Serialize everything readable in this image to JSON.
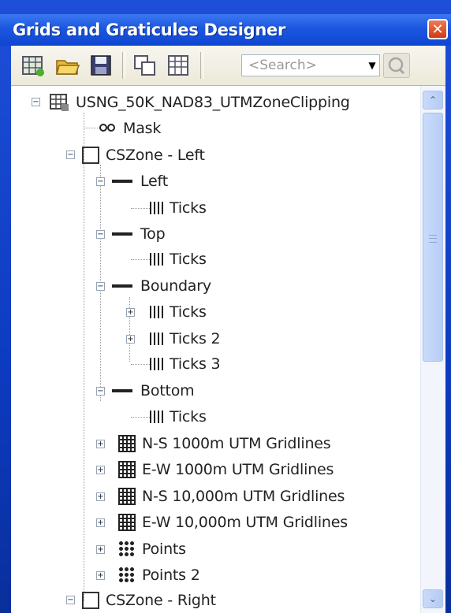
{
  "window": {
    "title": "Grids and Graticules Designer",
    "close_glyph": "✕"
  },
  "toolbar": {
    "buttons": [
      "new-grid-icon",
      "open-folder-icon",
      "save-icon",
      "copy-icon",
      "properties-icon"
    ],
    "search_placeholder": "<Search>",
    "search_dropdown_glyph": "▼",
    "search_go_icon": "magnifier-icon"
  },
  "tree": {
    "root_label": "USNG_50K_NAD83_UTMZoneClipping",
    "mask_label": "Mask",
    "cszone_left_label": "CSZone - Left",
    "left_label": "Left",
    "left_ticks_label": "Ticks",
    "top_label": "Top",
    "top_ticks_label": "Ticks",
    "boundary_label": "Boundary",
    "boundary_ticks_label": "Ticks",
    "boundary_ticks2_label": "Ticks 2",
    "boundary_ticks3_label": "Ticks 3",
    "bottom_label": "Bottom",
    "bottom_ticks_label": "Ticks",
    "ns1000_label": "N-S 1000m UTM Gridlines",
    "ew1000_label": "E-W 1000m UTM Gridlines",
    "ns10000_label": "N-S 10,000m UTM Gridlines",
    "ew10000_label": "E-W 10,000m UTM Gridlines",
    "points_label": "Points",
    "points2_label": "Points 2",
    "cszone_right_label": "CSZone - Right"
  },
  "scrollbar": {
    "up_glyph": "⌃",
    "down_glyph": "⌄"
  },
  "colors": {
    "titlebar": "#1b56e0",
    "toolbar": "#ece9d8",
    "panel": "#ffffff"
  }
}
